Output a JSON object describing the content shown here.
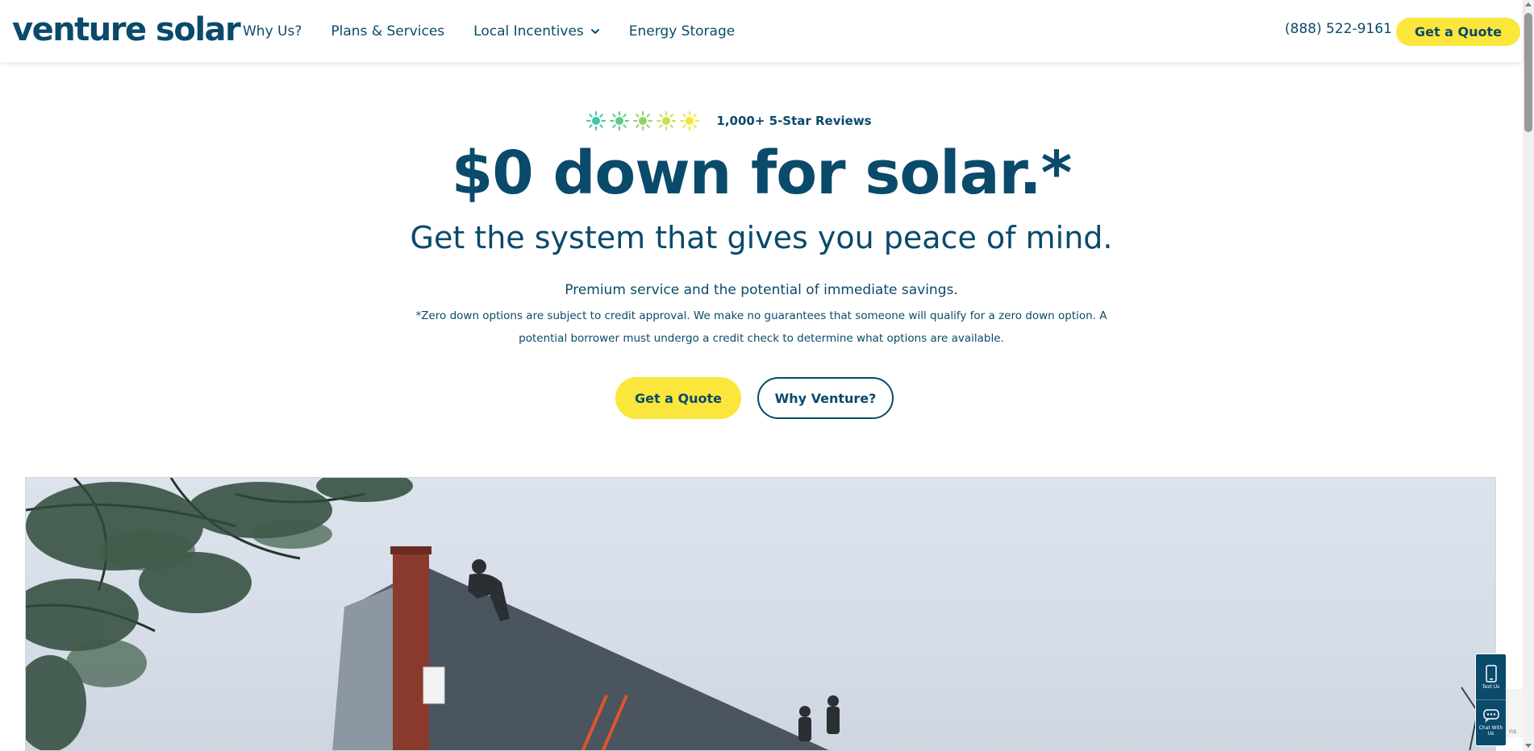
{
  "header": {
    "logo": "venture solar",
    "nav": [
      {
        "label": "Why Us?"
      },
      {
        "label": "Plans & Services"
      },
      {
        "label": "Local Incentives"
      },
      {
        "label": "Energy Storage"
      }
    ],
    "phone": "(888) 522-9161",
    "cta": "Get a Quote"
  },
  "hero": {
    "reviews": "1,000+ 5-Star Reviews",
    "star_colors": [
      "#3fc7a8",
      "#5ccb8f",
      "#8fd46a",
      "#c9df4e",
      "#f5e33a"
    ],
    "headline": "$0 down for solar.*",
    "subhead": "Get the system that gives you peace of mind.",
    "tagline": "Premium service and the potential of immediate savings.",
    "disclaimer": "*Zero down options are subject to credit approval. We make no guarantees that someone will qualify for a zero down option. A potential borrower must undergo a credit check to determine what options are available.",
    "buttons": {
      "quote": "Get a Quote",
      "why": "Why Venture?"
    }
  },
  "widget": {
    "text_us": "Text Us",
    "chat": "Chat With Us"
  },
  "colors": {
    "brand": "#0a4a6b",
    "accent": "#fbe63b"
  }
}
